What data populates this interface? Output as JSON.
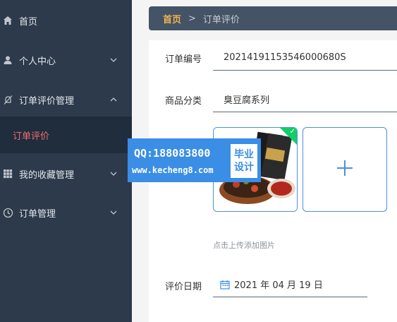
{
  "sidebar": {
    "items": [
      {
        "label": "首页",
        "icon": "home-icon"
      },
      {
        "label": "个人中心",
        "icon": "user-icon"
      },
      {
        "label": "订单评价管理",
        "icon": "bell-off-icon"
      },
      {
        "label": "订单评价",
        "icon": ""
      },
      {
        "label": "我的收藏管理",
        "icon": "grid-icon"
      },
      {
        "label": "订单管理",
        "icon": "clock-icon"
      }
    ]
  },
  "breadcrumb": {
    "home": "首页",
    "separator": ">",
    "current": "订单评价"
  },
  "form": {
    "order_no_label": "订单编号",
    "order_no_value": "20214191153546000680S",
    "category_label": "商品分类",
    "category_value": "臭豆腐系列",
    "upload_hint": "点击上传添加图片",
    "date_label": "评价日期",
    "date_value": "2021 年 04 月 19 日"
  },
  "watermark": {
    "qq": "QQ:188083800",
    "url": "www.kecheng8.com",
    "badge_line1": "毕业",
    "badge_line2": "设计"
  },
  "colors": {
    "sidebar_bg": "#2d3a4b",
    "active_text": "#f56c6c",
    "breadcrumb_home": "#f0b34e",
    "upload_border": "#4a90e2",
    "success": "#13ce66"
  }
}
